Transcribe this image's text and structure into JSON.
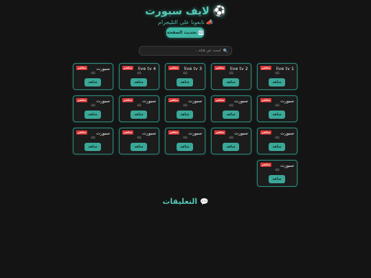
{
  "header": {
    "logo_icon": "⚽",
    "title": "لايف سبورت",
    "tagline_icon": "📣",
    "tagline": "تابعونا على التليجرام"
  },
  "toolbar": {
    "refresh_icon": "🔄",
    "refresh_label": "تحديث الصفحة"
  },
  "search": {
    "placeholder": "ابحث عن قناة..."
  },
  "channels": [
    {
      "name": "live tv 1",
      "quality": "HD",
      "badge": "مباشر",
      "watch_label": "شاهد"
    },
    {
      "name": "live tv 2",
      "quality": "HD",
      "badge": "مباشر",
      "watch_label": "شاهد"
    },
    {
      "name": "live tv 3",
      "quality": "HD",
      "badge": "مباشر",
      "watch_label": "شاهد"
    },
    {
      "name": "live tv 4",
      "quality": "HD",
      "badge": "مباشر",
      "watch_label": "شاهد"
    },
    {
      "name": "سبورت",
      "quality": "HD",
      "badge": "مباشر",
      "watch_label": "شاهد"
    },
    {
      "name": "سبورت",
      "quality": "HD",
      "badge": "مباشر",
      "watch_label": "شاهد"
    },
    {
      "name": "سبورت",
      "quality": "HD",
      "badge": "مباشر",
      "watch_label": "شاهد"
    },
    {
      "name": "سبورت",
      "quality": "HD",
      "badge": "مباشر",
      "watch_label": "شاهد"
    },
    {
      "name": "سبورت",
      "quality": "HD",
      "badge": "مباشر",
      "watch_label": "شاهد"
    },
    {
      "name": "سبورت",
      "quality": "HD",
      "badge": "مباشر",
      "watch_label": "شاهد"
    },
    {
      "name": "سبورت",
      "quality": "HD",
      "badge": "مباشر",
      "watch_label": "شاهد"
    },
    {
      "name": "سبورت",
      "quality": "HD",
      "badge": "مباشر",
      "watch_label": "شاهد"
    },
    {
      "name": "سبورت",
      "quality": "HD",
      "badge": "مباشر",
      "watch_label": "شاهد"
    },
    {
      "name": "سبورت",
      "quality": "HD",
      "badge": "مباشر",
      "watch_label": "شاهد"
    },
    {
      "name": "سبورت",
      "quality": "HD",
      "badge": "مباشر",
      "watch_label": "شاهد"
    },
    {
      "name": "سبورت",
      "quality": "HD",
      "badge": "مباشر",
      "watch_label": "شاهد"
    }
  ],
  "comments": {
    "icon": "💬",
    "title": "التعليقات"
  },
  "colors": {
    "accent": "#3fb7a6",
    "live_badge": "#e03b3b",
    "background": "#141414"
  }
}
